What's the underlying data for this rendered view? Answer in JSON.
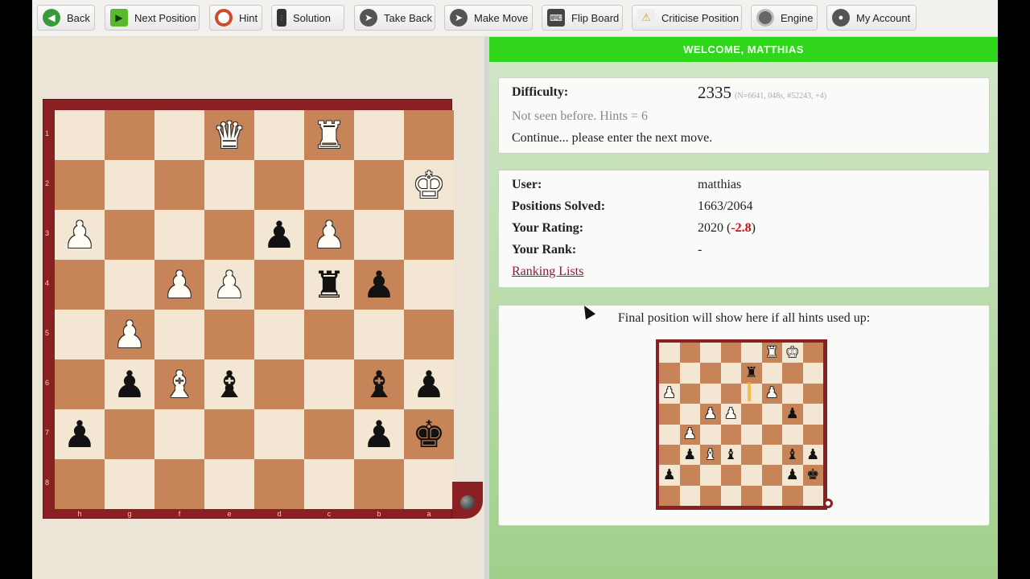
{
  "toolbar": {
    "buttons": [
      {
        "label": "Back",
        "icon": "back-arrow-icon"
      },
      {
        "label": "Next Position",
        "icon": "play-icon"
      },
      {
        "label": "Hint",
        "icon": "lifebuoy-icon"
      },
      {
        "label": "Solution",
        "icon": "traffic-light-icon"
      },
      {
        "label": "Take Back",
        "icon": "left-arrow-icon"
      },
      {
        "label": "Make Move",
        "icon": "right-arrow-icon"
      },
      {
        "label": "Flip Board",
        "icon": "typewriter-icon"
      },
      {
        "label": "Criticise Position",
        "icon": "warning-icon"
      },
      {
        "label": "Engine",
        "icon": "film-reel-icon"
      },
      {
        "label": "My Account",
        "icon": "user-icon"
      }
    ]
  },
  "welcome": "WELCOME, MATTHIAS",
  "puzzle": {
    "difficulty_label": "Difficulty:",
    "difficulty_value": "2335",
    "difficulty_meta": "(N=6641, 048s, #52243, +4)",
    "status": "Not seen before. Hints = 6",
    "prompt": "Continue... please enter the next move."
  },
  "user_panel": {
    "user_label": "User:",
    "user_value": "matthias",
    "solved_label": "Positions Solved:",
    "solved_value": "1663/2064",
    "rating_label": "Your Rating:",
    "rating_value": "2020 (",
    "rating_change": "-2.8",
    "rating_close": ")",
    "rank_label": "Your Rank:",
    "rank_value": "-",
    "ranking_link": "Ranking Lists"
  },
  "final_panel": {
    "caption": "Final position will show here if all hints used up:"
  },
  "board": {
    "orientation": "flipped",
    "ranks": [
      "1",
      "2",
      "3",
      "4",
      "5",
      "6",
      "7",
      "8"
    ],
    "files": [
      "h",
      "g",
      "f",
      "e",
      "d",
      "c",
      "b",
      "a"
    ],
    "rows": [
      [
        "",
        "",
        "",
        "wQ",
        "",
        "wR",
        "",
        ""
      ],
      [
        "",
        "",
        "",
        "",
        "",
        "",
        "",
        "wK"
      ],
      [
        "wP",
        "",
        "",
        "",
        "bP",
        "wP",
        "",
        ""
      ],
      [
        "",
        "",
        "wP",
        "wP",
        "",
        "bR",
        "bP",
        ""
      ],
      [
        "",
        "wP",
        "",
        "",
        "",
        "",
        "",
        ""
      ],
      [
        "",
        "bP",
        "wB",
        "bB",
        "",
        "",
        "bB",
        "bP"
      ],
      [
        "bP",
        "",
        "",
        "",
        "",
        "",
        "bP",
        "bK"
      ],
      [
        "",
        "",
        "",
        "",
        "",
        "",
        "",
        ""
      ]
    ]
  },
  "mini_board": {
    "rows": [
      [
        "",
        "",
        "",
        "",
        "",
        "wR",
        "wK",
        ""
      ],
      [
        "",
        "",
        "",
        "",
        "bR",
        "",
        "",
        ""
      ],
      [
        "wP",
        "",
        "",
        "",
        "",
        "wP",
        "",
        ""
      ],
      [
        "",
        "",
        "wP",
        "wP",
        "",
        "",
        "bP",
        ""
      ],
      [
        "",
        "wP",
        "",
        "",
        "",
        "",
        "",
        ""
      ],
      [
        "",
        "bP",
        "wB",
        "bB",
        "",
        "",
        "bB",
        "bP"
      ],
      [
        "bP",
        "",
        "",
        "",
        "",
        "",
        "bP",
        "bK"
      ],
      [
        "",
        "",
        "",
        "",
        "",
        "",
        "",
        ""
      ]
    ]
  },
  "colors": {
    "light_square": "#f3e7d4",
    "dark_square": "#c78458",
    "frame": "#8a1f24",
    "welcome_bar": "#2fd61a"
  }
}
